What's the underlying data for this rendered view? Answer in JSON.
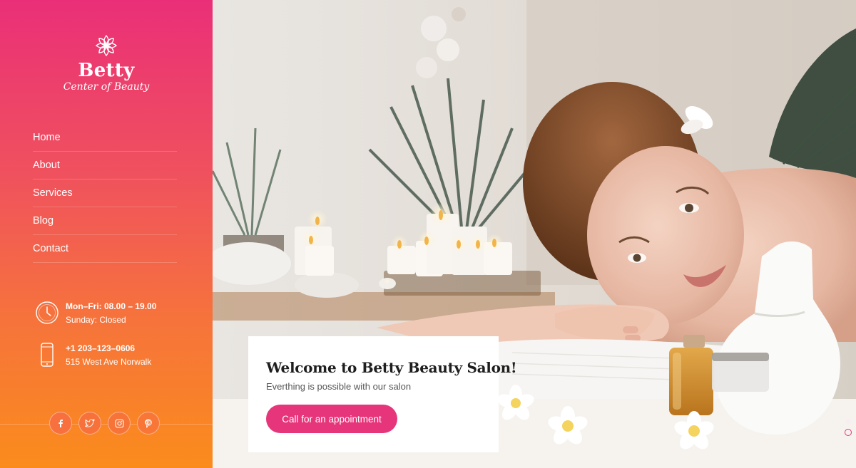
{
  "brand": {
    "name": "Betty",
    "tagline": "Center of Beauty"
  },
  "nav": {
    "items": [
      {
        "label": "Home"
      },
      {
        "label": "About"
      },
      {
        "label": "Services"
      },
      {
        "label": "Blog"
      },
      {
        "label": "Contact"
      }
    ]
  },
  "hours": {
    "weekdays": "Mon–Fri: 08.00 – 19.00",
    "sunday": "Sunday: Closed"
  },
  "contact": {
    "phone": "+1 203–123–0606",
    "address": "515 West Ave Norwalk"
  },
  "social": [
    "facebook-icon",
    "twitter-icon",
    "instagram-icon",
    "pinterest-icon"
  ],
  "hero": {
    "title": "Welcome to Betty Beauty Salon!",
    "subtitle": "Everthing is possible with our salon",
    "cta_label": "Call for an appointment"
  },
  "colors": {
    "sidebar_top": "#ea2f78",
    "sidebar_bottom": "#fb8c1c",
    "accent": "#e6357a"
  },
  "slider": {
    "slide_count": 2,
    "active_index": 1
  }
}
